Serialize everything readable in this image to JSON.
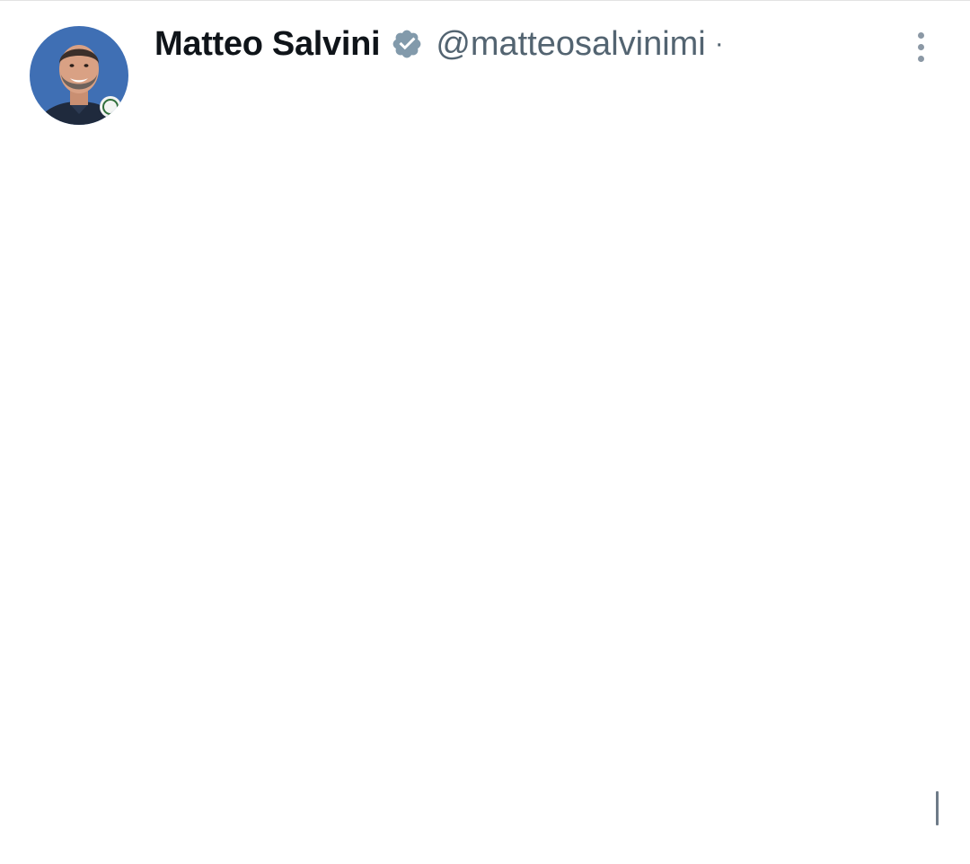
{
  "tweet": {
    "author": {
      "display_name": "Matteo Salvini",
      "handle": "@matteosalvinimi",
      "verified": true,
      "separator": "·"
    },
    "body_text": ""
  },
  "icons": {
    "verified": "verified-badge-icon",
    "more": "more-vertical-icon"
  },
  "colors": {
    "name": "#0f1419",
    "handle": "#536471",
    "verified_badge": "#829aab",
    "avatar_background": "#3f6fb4"
  }
}
